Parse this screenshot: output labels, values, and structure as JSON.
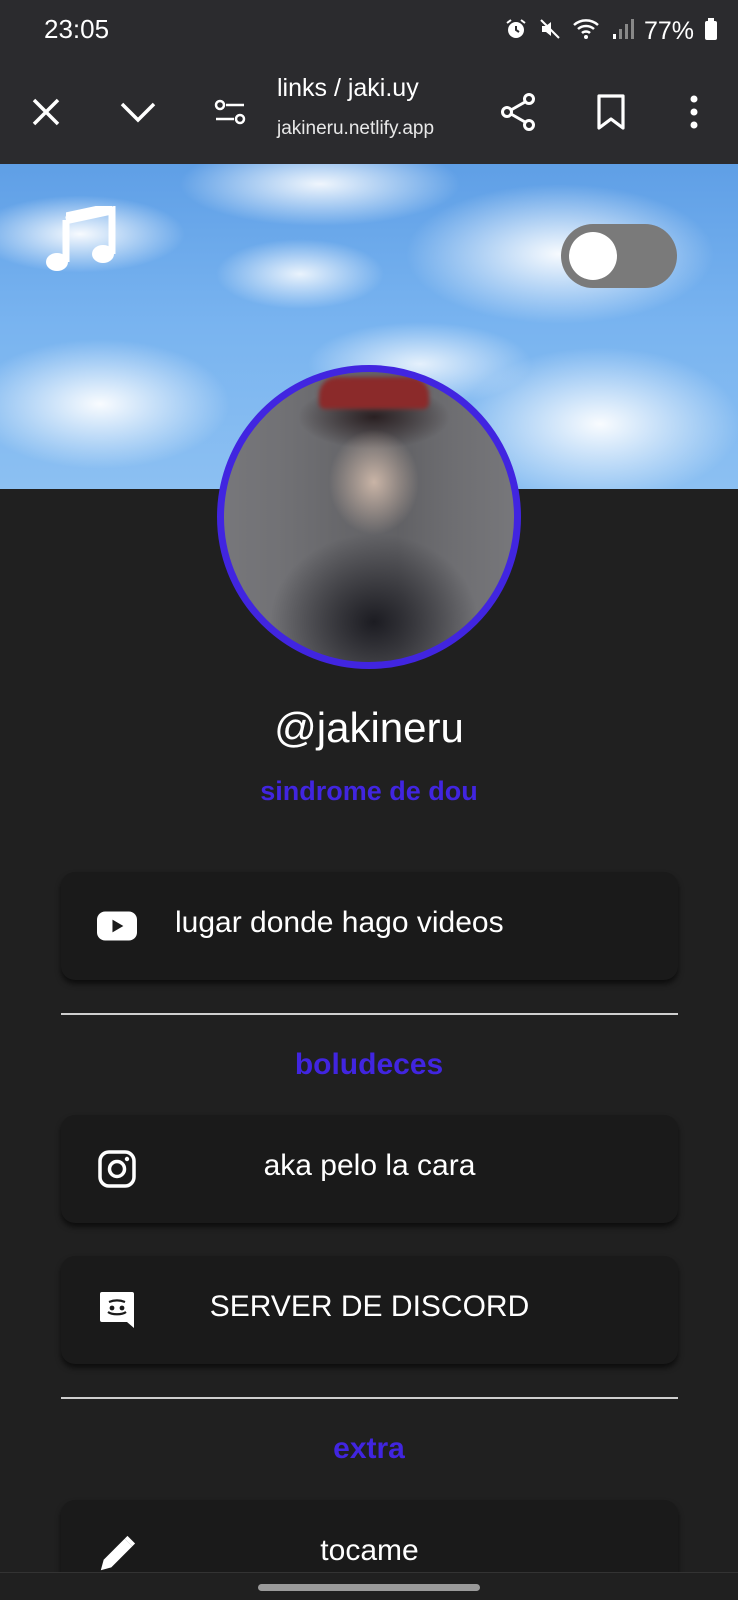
{
  "status_bar": {
    "time": "23:05",
    "battery": "77%"
  },
  "toolbar": {
    "title": "links / jaki.uy",
    "url": "jakineru.netlify.app"
  },
  "profile": {
    "username": "@jakineru",
    "tagline": "sindrome de dou"
  },
  "links": [
    {
      "label": "lugar donde hago videos",
      "icon": "youtube-icon"
    }
  ],
  "sections": [
    {
      "title": "boludeces",
      "links": [
        {
          "label": "aka pelo la cara",
          "icon": "instagram-icon"
        },
        {
          "label": "SERVER DE DISCORD",
          "icon": "discord-icon"
        }
      ]
    },
    {
      "title": "extra",
      "links": [
        {
          "label": "tocame",
          "icon": "pencil-icon"
        }
      ]
    }
  ],
  "colors": {
    "accent": "#4125e0",
    "card": "#1a1a1a",
    "page_bg": "#202020",
    "chrome_bg": "#2b2b2e"
  },
  "theme_toggle": {
    "on": false
  }
}
